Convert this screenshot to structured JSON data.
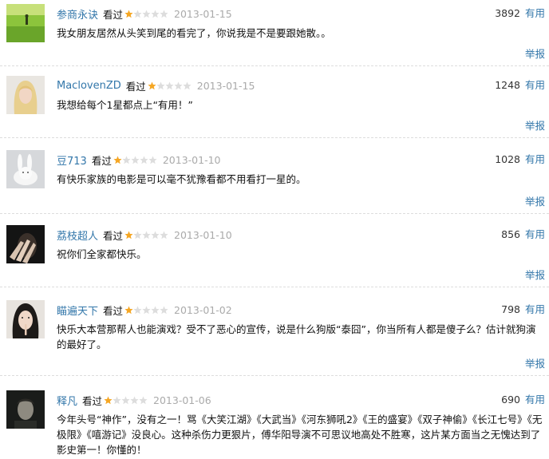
{
  "labels": {
    "seen": "看过",
    "useful": "有用",
    "report": "举报"
  },
  "colors": {
    "link": "#3377aa",
    "date": "#aaaaaa",
    "star_on": "#f5a623",
    "star_off": "#dddddd"
  },
  "reviews": [
    {
      "user": "参商永诀",
      "rating": 1,
      "max_rating": 5,
      "date": "2013-01-15",
      "useful_count": "3892",
      "text": "我女朋友居然从头笑到尾的看完了，你说我是不是要跟她散。。",
      "avatar": "grass-field-photo"
    },
    {
      "user": "MaclovenZD",
      "rating": 1,
      "max_rating": 5,
      "date": "2013-01-15",
      "useful_count": "1248",
      "text": "我想给每个1星都点上“有用！”",
      "avatar": "blonde-girl-photo"
    },
    {
      "user": "豆713",
      "rating": 1,
      "max_rating": 5,
      "date": "2013-01-10",
      "useful_count": "1028",
      "text": "有快乐家族的电影是可以毫不犹豫看都不用看打一星的。",
      "avatar": "white-rabbit-photo"
    },
    {
      "user": "荔枝超人",
      "rating": 1,
      "max_rating": 5,
      "date": "2013-01-10",
      "useful_count": "856",
      "text": "祝你们全家都快乐。",
      "avatar": "hand-on-face-photo"
    },
    {
      "user": "瞄遍天下",
      "rating": 1,
      "max_rating": 5,
      "date": "2013-01-02",
      "useful_count": "798",
      "text": "快乐大本营那帮人也能演戏？受不了恶心的宣传，说是什么狗版“泰囧”，你当所有人都是傻子么？估计就狗演的最好了。",
      "avatar": "girl-finger-lips-photo"
    },
    {
      "user": "释凡",
      "rating": 1,
      "max_rating": 5,
      "date": "2013-01-06",
      "useful_count": "690",
      "text": "今年头号“神作”，没有之一！骂《大笑江湖》《大武当》《河东狮吼2》《王的盛宴》《双子神偷》《长江七号》《无极限》《嘻游记》没良心。这种杀伤力更狠片，傅华阳导演不可思议地高处不胜寒，这片某方面当之无愧达到了影史第一！你懂的！",
      "avatar": "man-dark-portrait-photo"
    }
  ]
}
